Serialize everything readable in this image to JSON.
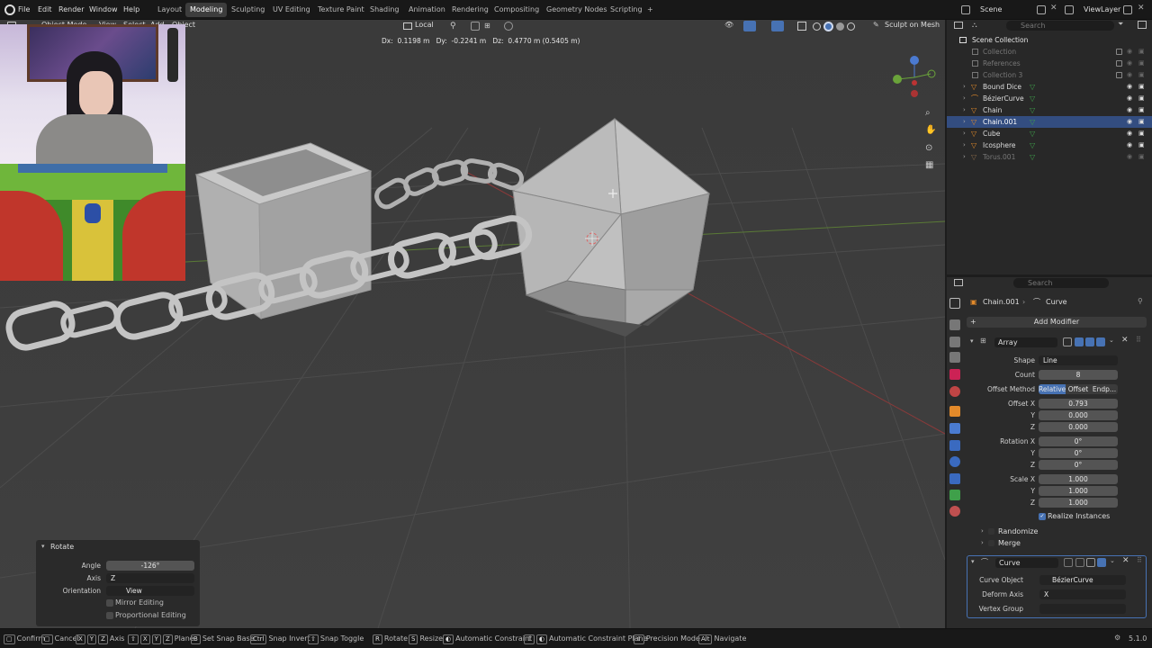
{
  "menus": [
    "File",
    "Edit",
    "Render",
    "Window",
    "Help"
  ],
  "workspaces": [
    "Layout",
    "Modeling",
    "Sculpting",
    "UV Editing",
    "Texture Paint",
    "Shading",
    "Animation",
    "Rendering",
    "Compositing",
    "Geometry Nodes",
    "Scripting"
  ],
  "active_workspace": "Modeling",
  "scene_label": "Scene",
  "view_layer_label": "ViewLayer",
  "viewport": {
    "mode": "Object Mode",
    "menus": [
      "View",
      "Select",
      "Add",
      "Object"
    ],
    "orientation": "Local",
    "sculpt_btn": "Sculpt on Mesh",
    "transform_info": "Dx:  0.1198 m   Dy:  -0.2241 m   Dz:  0.4770 m (0.5405 m)"
  },
  "outliner": {
    "search_placeholder": "Search",
    "title": "Scene Collection",
    "items": [
      {
        "name": "Collection",
        "dim": true
      },
      {
        "name": "References",
        "dim": true
      },
      {
        "name": "Collection 3",
        "dim": true
      },
      {
        "name": "Bound Dice",
        "dim": false
      },
      {
        "name": "BézierCurve",
        "dim": false
      },
      {
        "name": "Chain",
        "dim": false
      },
      {
        "name": "Chain.001",
        "dim": false,
        "selected": true
      },
      {
        "name": "Cube",
        "dim": false
      },
      {
        "name": "Icosphere",
        "dim": false
      },
      {
        "name": "Torus.001",
        "dim": true
      }
    ]
  },
  "properties": {
    "search_placeholder": "Search",
    "breadcrumb_obj": "Chain.001",
    "breadcrumb_mod": "Curve",
    "add_modifier": "Add Modifier",
    "array": {
      "name": "Array",
      "shape_label": "Shape",
      "shape": "Line",
      "count_label": "Count",
      "count": "8",
      "offset_method_label": "Offset Method",
      "offset_methods": [
        "Relative",
        "Offset",
        "Endp..."
      ],
      "offset_x_label": "Offset X",
      "offset_x": "0.793",
      "offset_y": "0.000",
      "offset_z": "0.000",
      "rotation_x_label": "Rotation X",
      "rot_x": "0°",
      "rot_y": "0°",
      "rot_z": "0°",
      "scale_x_label": "Scale X",
      "scale_x": "1.000",
      "scale_y": "1.000",
      "scale_z": "1.000",
      "y_label": "Y",
      "z_label": "Z",
      "realize": "Realize Instances",
      "randomize": "Randomize",
      "merge": "Merge"
    },
    "curve": {
      "name": "Curve",
      "object_label": "Curve Object",
      "object": "BézierCurve",
      "deform_label": "Deform Axis",
      "deform": "X",
      "vgroup_label": "Vertex Group"
    }
  },
  "rotate_panel": {
    "title": "Rotate",
    "angle_label": "Angle",
    "angle": "-126°",
    "axis_label": "Axis",
    "axis": "Z",
    "orientation_label": "Orientation",
    "orientation": "View",
    "mirror": "Mirror Editing",
    "proportional": "Proportional Editing"
  },
  "statusbar": {
    "confirm": "Confirm",
    "cancel": "Cancel",
    "axis": "Axis",
    "plane": "Plane",
    "snap_base": "Set Snap Base",
    "snap_invert_key": "Ctrl",
    "snap_invert": "Snap Invert",
    "snap_toggle": "Snap Toggle",
    "rotate": "Rotate",
    "resize": "Resize",
    "auto_constraint": "Automatic Constraint",
    "auto_constraint_plane": "Automatic Constraint Plane",
    "precision": "Precision Mode",
    "navigate_key": "Alt",
    "navigate": "Navigate",
    "version": "5.1.0"
  },
  "colors": {
    "accent": "#4772b3",
    "selected_row": "#334d80",
    "mesh": "#b5b5b5"
  }
}
